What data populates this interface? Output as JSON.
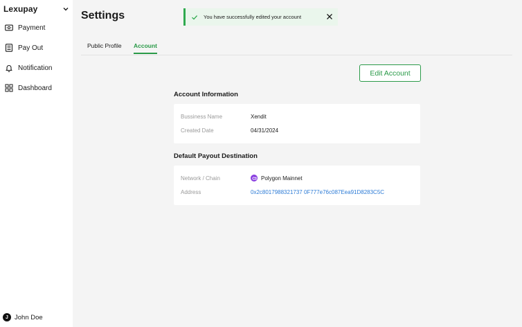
{
  "sidebar": {
    "brand": "Lexupay",
    "items": [
      {
        "label": "Payment",
        "icon": "payment-icon"
      },
      {
        "label": "Pay Out",
        "icon": "payout-icon"
      },
      {
        "label": "Notification",
        "icon": "bell-icon"
      },
      {
        "label": "Dashboard",
        "icon": "dashboard-icon"
      }
    ],
    "user": {
      "initial": "J",
      "name": "John Doe"
    }
  },
  "header": {
    "title": "Settings"
  },
  "toast": {
    "message": "You have successfully edited your account",
    "color": "#2faa4e"
  },
  "tabs": [
    {
      "label": "Public Profile",
      "active": false
    },
    {
      "label": "Account",
      "active": true
    }
  ],
  "actions": {
    "edit_label": "Edit Account"
  },
  "account_info": {
    "title": "Account Information",
    "business_name_label": "Bussiness Name",
    "business_name_value": "Xendit",
    "created_date_label": "Created Date",
    "created_date_value": "04/31/2024"
  },
  "payout": {
    "title": "Default Payout Destination",
    "network_label": "Network / Chain",
    "network_value": "Polygon Mainnet",
    "address_label": "Address",
    "address_value": "0x2c8017988321737 0F777e76c087Eea91D8283C5C"
  },
  "colors": {
    "accent": "#2a9a48",
    "link": "#2c7bd6",
    "polygon": "#8a3fe0"
  }
}
